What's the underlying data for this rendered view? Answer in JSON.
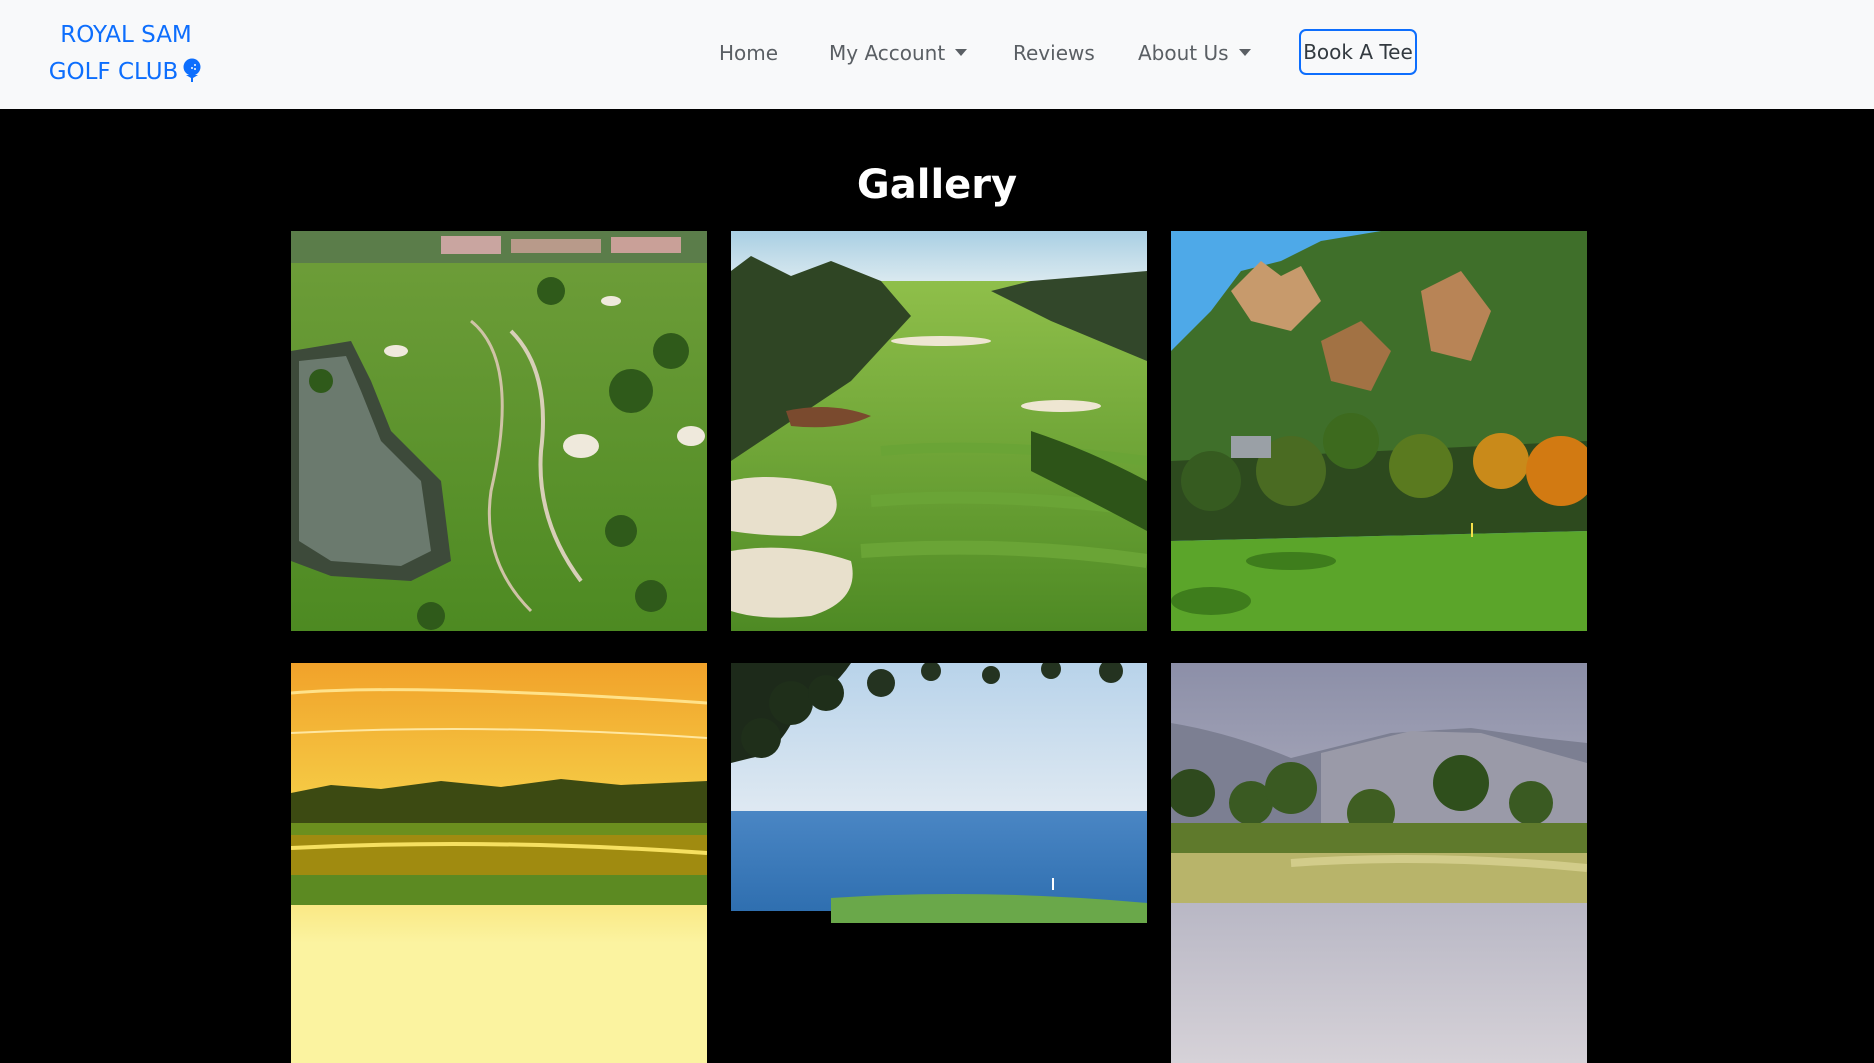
{
  "navbar": {
    "brand_line1": "ROYAL SAM",
    "brand_line2": "GOLF CLUB",
    "brand_icon": "golf-ball-tee-icon",
    "links": [
      {
        "label": "Home",
        "has_dropdown": false
      },
      {
        "label": "My Account",
        "has_dropdown": true
      },
      {
        "label": "Reviews",
        "has_dropdown": false
      },
      {
        "label": "About Us",
        "has_dropdown": true
      }
    ],
    "cta_label": "Book A Tee"
  },
  "main": {
    "title": "Gallery",
    "images": [
      {
        "scene": "aerial course with palms and lake"
      },
      {
        "scene": "pine-lined fairway with bunkers"
      },
      {
        "scene": "mountain course with autumn trees"
      },
      {
        "scene": "sunset over golf lake"
      },
      {
        "scene": "ocean view through tree branches"
      },
      {
        "scene": "mountain valley green"
      }
    ]
  },
  "colors": {
    "brand": "#0d6efd",
    "navbar_bg": "#f8f9fa",
    "page_bg": "#000000",
    "nav_text": "#5a5f64"
  }
}
